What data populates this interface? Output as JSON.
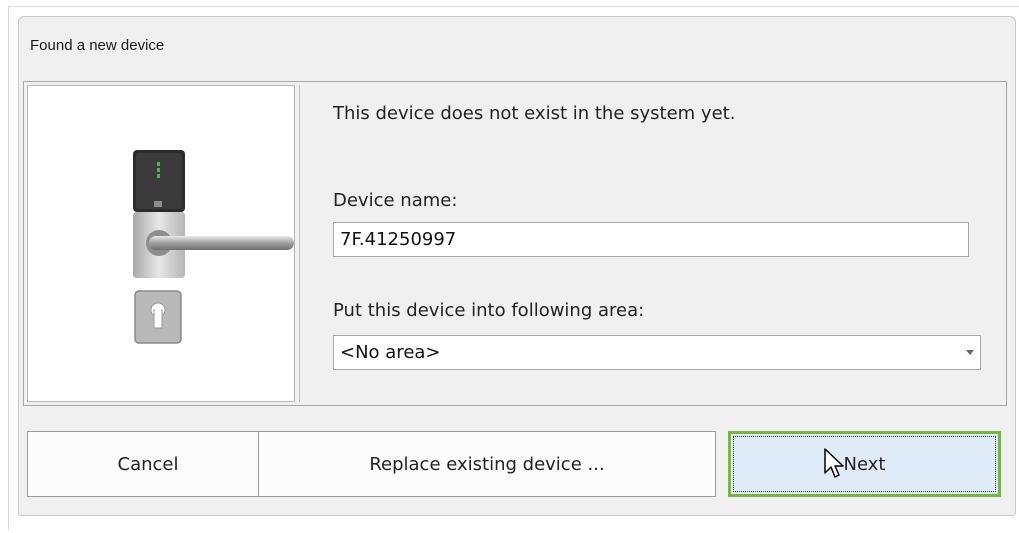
{
  "dialog": {
    "title": "Found a new device"
  },
  "image_panel": {
    "icon": "door-lock-handle-icon"
  },
  "form": {
    "info_text": "This device does not exist in the system yet.",
    "device_name_label": "Device name:",
    "device_name_value": "7F.41250997",
    "area_label": "Put this device into following area:",
    "area_selected": "<No area>"
  },
  "buttons": {
    "cancel": "Cancel",
    "replace": "Replace existing device ...",
    "next": "Next"
  },
  "colors": {
    "focus_border": "#79b44a",
    "next_bg": "#e0ebf9",
    "dialog_bg": "#f0f0f0"
  }
}
